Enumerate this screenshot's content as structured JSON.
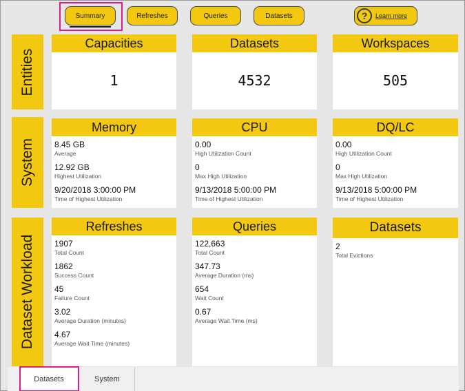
{
  "nav": {
    "summary": "Summary",
    "refreshes": "Refreshes",
    "queries": "Queries",
    "datasets": "Datasets",
    "learn_more": "Learn more",
    "help_icon": "?"
  },
  "sections": {
    "entities": "Entities",
    "system": "System",
    "workload": "Dataset Workload"
  },
  "entities": {
    "capacities": {
      "title": "Capacities",
      "value": "1"
    },
    "datasets": {
      "title": "Datasets",
      "value": "4532"
    },
    "workspaces": {
      "title": "Workspaces",
      "value": "505"
    }
  },
  "system": {
    "memory": {
      "title": "Memory",
      "stats": [
        {
          "value": "8.45 GB",
          "label": "Average"
        },
        {
          "value": "12.92 GB",
          "label": "Highest Utilization"
        },
        {
          "value": "9/20/2018 3:00:00 PM",
          "label": "Time of Highest Utilization"
        }
      ]
    },
    "cpu": {
      "title": "CPU",
      "stats": [
        {
          "value": "0.00",
          "label": "High Utilization Count"
        },
        {
          "value": "0",
          "label": "Max High Utilization"
        },
        {
          "value": "9/13/2018 5:00:00 PM",
          "label": "Time of Highest Utilization"
        }
      ]
    },
    "dqlc": {
      "title": "DQ/LC",
      "stats": [
        {
          "value": "0.00",
          "label": "High Utilization Count"
        },
        {
          "value": "0",
          "label": "Max High Utilization"
        },
        {
          "value": "9/13/2018 5:00:00 PM",
          "label": "Time of Highest Utilization"
        }
      ]
    }
  },
  "workload": {
    "refreshes": {
      "title": "Refreshes",
      "stats": [
        {
          "value": "1907",
          "label": "Total Count"
        },
        {
          "value": "1862",
          "label": "Success Count"
        },
        {
          "value": "45",
          "label": "Failure Count"
        },
        {
          "value": "3.02",
          "label": "Average Duration (minutes)"
        },
        {
          "value": "4.67",
          "label": "Average Wait Time (minutes)"
        }
      ]
    },
    "queries": {
      "title": "Queries",
      "stats": [
        {
          "value": "122,663",
          "label": "Total Count"
        },
        {
          "value": "347.73",
          "label": "Average Duration (ms)"
        },
        {
          "value": "654",
          "label": "Wait Count"
        },
        {
          "value": "0.67",
          "label": "Average Wait Time (ms)"
        }
      ]
    },
    "datasets": {
      "title": "Datasets",
      "stats": [
        {
          "value": "2",
          "label": "Total Evictions"
        }
      ]
    }
  },
  "tabs": {
    "datasets": "Datasets",
    "system": "System"
  },
  "colors": {
    "accent": "#f2c811",
    "highlight": "#e5198a",
    "background": "#e6e6e6"
  }
}
